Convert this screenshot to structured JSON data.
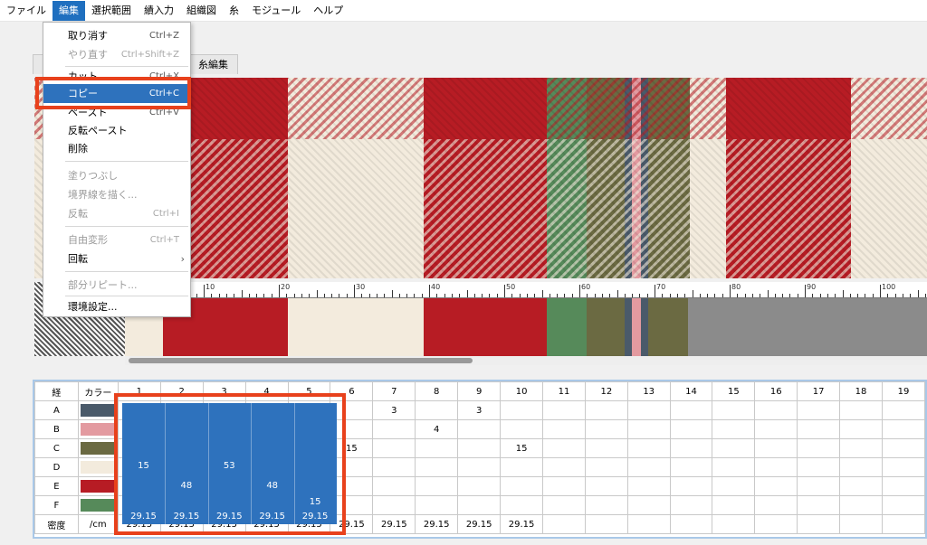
{
  "menubar": {
    "items": [
      "ファイル",
      "編集",
      "選択範囲",
      "績入力",
      "組織図",
      "糸",
      "モジュール",
      "ヘルプ"
    ]
  },
  "edit_menu": {
    "undo": {
      "label": "取り消す",
      "shortcut": "Ctrl+Z"
    },
    "redo": {
      "label": "やり直す",
      "shortcut": "Ctrl+Shift+Z"
    },
    "cut": {
      "label": "カット",
      "shortcut": "Ctrl+X"
    },
    "copy": {
      "label": "コピー",
      "shortcut": "Ctrl+C"
    },
    "paste": {
      "label": "ペースト",
      "shortcut": "Ctrl+V"
    },
    "reverse_paste": {
      "label": "反転ペースト"
    },
    "delete": {
      "label": "削除"
    },
    "fill": {
      "label": "塗りつぶし"
    },
    "draw_border": {
      "label": "境界線を描く..."
    },
    "invert": {
      "label": "反転",
      "shortcut": "Ctrl+I"
    },
    "free_transform": {
      "label": "自由変形",
      "shortcut": "Ctrl+T"
    },
    "rotate": {
      "label": "回転",
      "arrow": "›"
    },
    "partial_repeat": {
      "label": "部分リピート..."
    },
    "preferences": {
      "label": "環境設定..."
    }
  },
  "tabs": {
    "tab1": "",
    "yarn_edit": "糸編集"
  },
  "ruler": {
    "labels": [
      "10",
      "20",
      "30",
      "40",
      "50",
      "60",
      "70",
      "80",
      "90",
      "100"
    ]
  },
  "colors": {
    "A": "#4a5a6a",
    "B": "#e39aa0",
    "C": "#6b6a42",
    "D": "#f3ebdd",
    "E": "#b71c24",
    "F": "#568a5a",
    "gray": "#8b8b8b",
    "selection": "#2e72bd",
    "highlight_box": "#e8411c"
  },
  "table": {
    "header_label": "経",
    "color_label": "カラー",
    "density_label": "密度",
    "unit_label": "/cm",
    "row_labels": [
      "A",
      "B",
      "C",
      "D",
      "E",
      "F"
    ],
    "columns": [
      "1",
      "2",
      "3",
      "4",
      "5",
      "6",
      "7",
      "8",
      "9",
      "10",
      "11",
      "12",
      "13",
      "14",
      "15",
      "16",
      "17",
      "18",
      "19"
    ],
    "cells": {
      "A": [
        "",
        "",
        "",
        "",
        "",
        "",
        "3",
        "",
        "3",
        "",
        "",
        "",
        "",
        "",
        "",
        "",
        "",
        "",
        ""
      ],
      "B": [
        "",
        "",
        "",
        "",
        "",
        "",
        "",
        "4",
        "",
        "",
        "",
        "",
        "",
        "",
        "",
        "",
        "",
        "",
        ""
      ],
      "C": [
        "",
        "",
        "",
        "",
        "",
        "15",
        "",
        "",
        "",
        "15",
        "",
        "",
        "",
        "",
        "",
        "",
        "",
        "",
        ""
      ],
      "D": [
        "15",
        "",
        "53",
        "",
        "",
        "",
        "",
        "",
        "",
        "",
        "",
        "",
        "",
        "",
        "",
        "",
        "",
        "",
        ""
      ],
      "E": [
        "",
        "48",
        "",
        "48",
        "",
        "",
        "",
        "",
        "",
        "",
        "",
        "",
        "",
        "",
        "",
        "",
        "",
        "",
        ""
      ],
      "F": [
        "",
        "",
        "",
        "",
        "15",
        "",
        "",
        "",
        "",
        "",
        "",
        "",
        "",
        "",
        "",
        "",
        "",
        "",
        ""
      ]
    },
    "density": [
      "29.15",
      "29.15",
      "29.15",
      "29.15",
      "29.15",
      "29.15",
      "29.15",
      "29.15",
      "29.15",
      "29.15",
      "",
      "",
      "",
      "",
      "",
      "",
      "",
      "",
      ""
    ]
  }
}
